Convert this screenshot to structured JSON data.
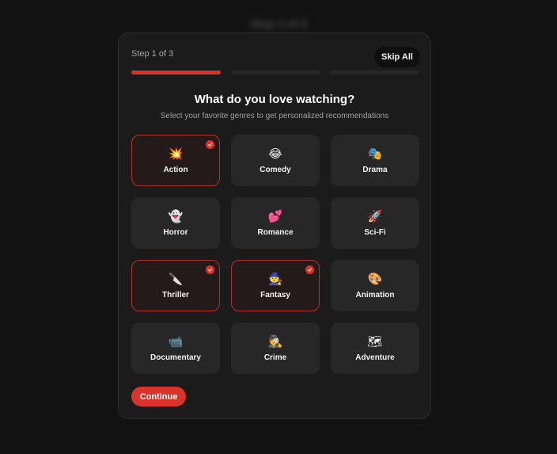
{
  "background": {
    "title": "Step 1 of 3"
  },
  "header": {
    "step_text": "Step 1 of 3",
    "skip_label": "Skip All"
  },
  "progress": {
    "current_step": 1,
    "total_steps": 3
  },
  "heading": "What do you love watching?",
  "subheading": "Select your favorite genres to get personalized recommendations",
  "genres": [
    {
      "name": "action",
      "label": "Action",
      "emoji": "💥",
      "selected": true
    },
    {
      "name": "comedy",
      "label": "Comedy",
      "emoji": "😂",
      "selected": false
    },
    {
      "name": "drama",
      "label": "Drama",
      "emoji": "🎭",
      "selected": false
    },
    {
      "name": "horror",
      "label": "Horror",
      "emoji": "👻",
      "selected": false
    },
    {
      "name": "romance",
      "label": "Romance",
      "emoji": "💕",
      "selected": false
    },
    {
      "name": "sci-fi",
      "label": "Sci-Fi",
      "emoji": "🚀",
      "selected": false
    },
    {
      "name": "thriller",
      "label": "Thriller",
      "emoji": "🔪",
      "selected": true
    },
    {
      "name": "fantasy",
      "label": "Fantasy",
      "emoji": "🧙",
      "selected": true
    },
    {
      "name": "animation",
      "label": "Animation",
      "emoji": "🎨",
      "selected": false
    },
    {
      "name": "documentary",
      "label": "Documentary",
      "emoji": "📹",
      "selected": false
    },
    {
      "name": "crime",
      "label": "Crime",
      "emoji": "🕵",
      "selected": false
    },
    {
      "name": "adventure",
      "label": "Adventure",
      "emoji": "🗺",
      "selected": false
    }
  ],
  "continue_label": "Continue",
  "colors": {
    "accent": "#d9332b",
    "card_bg": "#272727",
    "selected_bg": "#241a19",
    "modal_bg": "#1b1b1b",
    "page_bg": "#121212"
  }
}
